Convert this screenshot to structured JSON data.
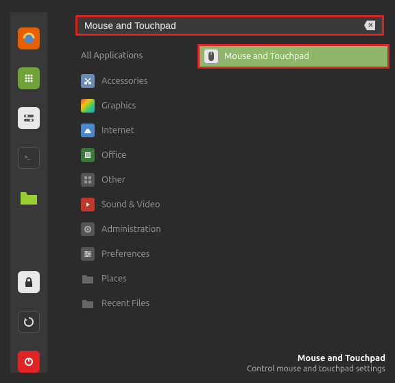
{
  "search": {
    "value": "Mouse and Touchpad"
  },
  "categories": {
    "header": "All Applications",
    "items": [
      {
        "label": "Accessories",
        "icon": "scissors-icon"
      },
      {
        "label": "Graphics",
        "icon": "graphics-icon"
      },
      {
        "label": "Internet",
        "icon": "internet-icon"
      },
      {
        "label": "Office",
        "icon": "office-icon"
      },
      {
        "label": "Other",
        "icon": "other-icon"
      },
      {
        "label": "Sound & Video",
        "icon": "sound-video-icon"
      },
      {
        "label": "Administration",
        "icon": "administration-icon"
      },
      {
        "label": "Preferences",
        "icon": "preferences-icon"
      },
      {
        "label": "Places",
        "icon": "places-icon"
      },
      {
        "label": "Recent Files",
        "icon": "recent-files-icon"
      }
    ]
  },
  "results": [
    {
      "label": "Mouse and Touchpad",
      "icon": "mouse-icon"
    }
  ],
  "footer": {
    "title": "Mouse and Touchpad",
    "desc": "Control mouse and touchpad settings"
  },
  "panel_icons": [
    "firefox-icon",
    "apps-icon",
    "settings-panel-icon",
    "terminal-icon",
    "files-icon",
    "lock-icon",
    "reload-icon",
    "power-icon"
  ]
}
